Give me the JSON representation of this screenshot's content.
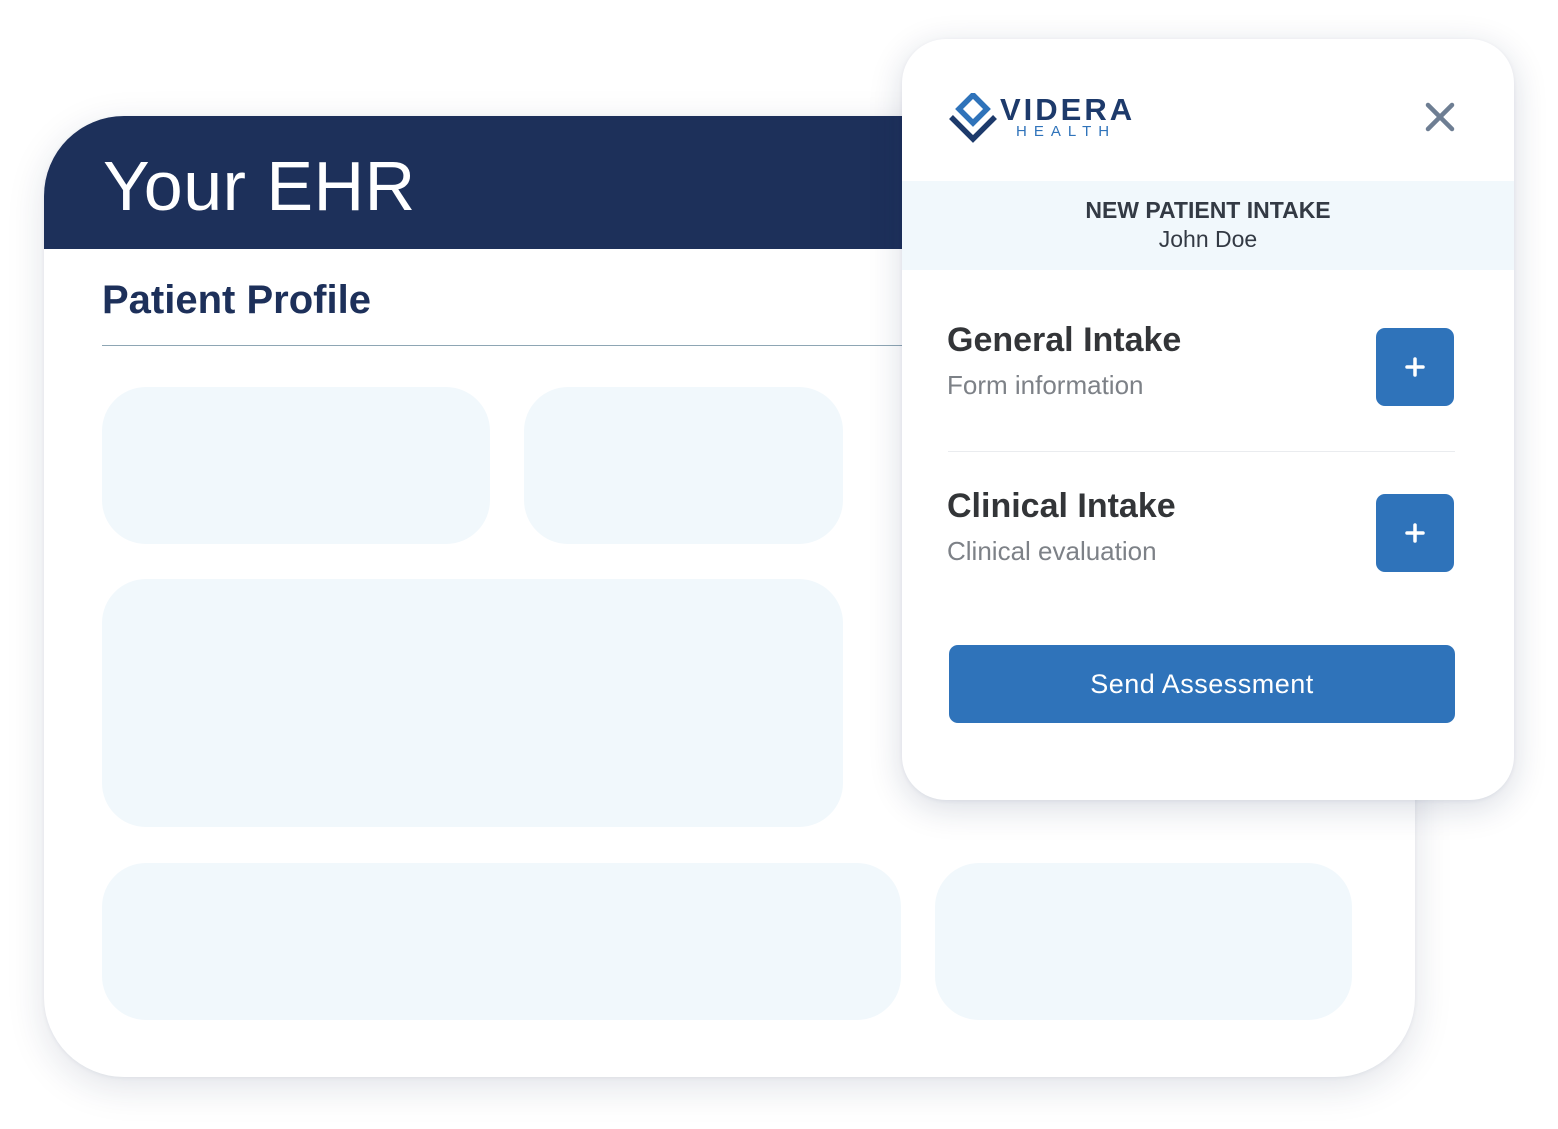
{
  "ehr": {
    "title": "Your EHR",
    "section_title": "Patient Profile"
  },
  "videra": {
    "brand": {
      "name": "VIDERA",
      "sub": "HEALTH"
    },
    "close_icon": "close-icon",
    "intake": {
      "title": "NEW PATIENT INTAKE",
      "patient_name": "John Doe"
    },
    "forms": [
      {
        "name": "General Intake",
        "description": "Form information",
        "add_icon": "plus-icon"
      },
      {
        "name": "Clinical Intake",
        "description": "Clinical evaluation",
        "add_icon": "plus-icon"
      }
    ],
    "send_button_label": "Send Assessment"
  },
  "colors": {
    "ehr_header": "#1d305a",
    "placeholder_card": "#f1f8fc",
    "accent_blue": "#2f73ba",
    "brand_navy": "#1d3a6b",
    "close_icon": "#6e7e93"
  }
}
